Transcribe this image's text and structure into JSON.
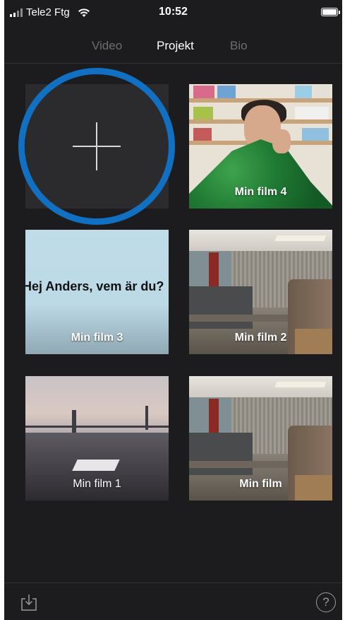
{
  "status_bar": {
    "carrier": "Tele2 Ftg",
    "time": "10:52"
  },
  "tabs": [
    {
      "label": "Video",
      "active": false
    },
    {
      "label": "Projekt",
      "active": true
    },
    {
      "label": "Bio",
      "active": false
    }
  ],
  "projects": {
    "new_project_icon": "plus-icon",
    "items": [
      {
        "title": "Min film 4"
      },
      {
        "title": "Min film 3",
        "overlay_text": "Hej Anders, vem är du?"
      },
      {
        "title": "Min film 2"
      },
      {
        "title": "Min film 1"
      },
      {
        "title": "Min film"
      }
    ]
  },
  "bottom_bar": {
    "left_icon": "share-icon",
    "right_icon": "help-icon",
    "help_glyph": "?"
  },
  "colors": {
    "background": "#1c1c1e",
    "highlight_ring": "#1170c2",
    "active_tab": "#ffffff",
    "inactive_tab": "#6e6e70"
  }
}
